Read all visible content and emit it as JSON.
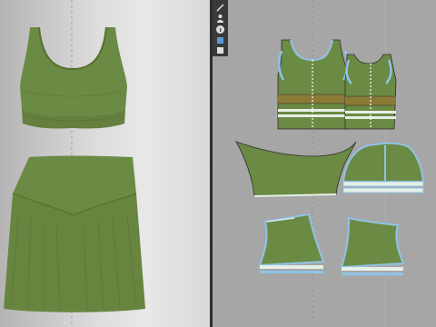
{
  "app": {
    "name": "",
    "viewports": [
      "3d-avatar-window",
      "2d-pattern-window"
    ]
  },
  "colors": {
    "fabric": "#6b8a43",
    "fabric_dark": "#55702f",
    "elastic_band": "#8a7a35",
    "selected_outline": "#8fc3e6",
    "view2d_background": "#a6a6a6",
    "view3d_background": "#e0e0e0",
    "toolbar": "#3a3a3a"
  },
  "toolbar": {
    "tools": [
      {
        "icon": "pen-icon"
      },
      {
        "icon": "avatar-icon"
      },
      {
        "icon": "info-icon"
      },
      {
        "icon": "fabric-icon"
      },
      {
        "icon": "garment-icon"
      }
    ]
  },
  "garment_3d": {
    "items": [
      "crop-top",
      "skirt"
    ]
  },
  "pattern_2d": {
    "pieces": [
      "front-bodice-piece",
      "back-bodice-piece",
      "waistband-piece",
      "skort-front-piece",
      "shorts-left-piece",
      "shorts-right-piece"
    ]
  }
}
